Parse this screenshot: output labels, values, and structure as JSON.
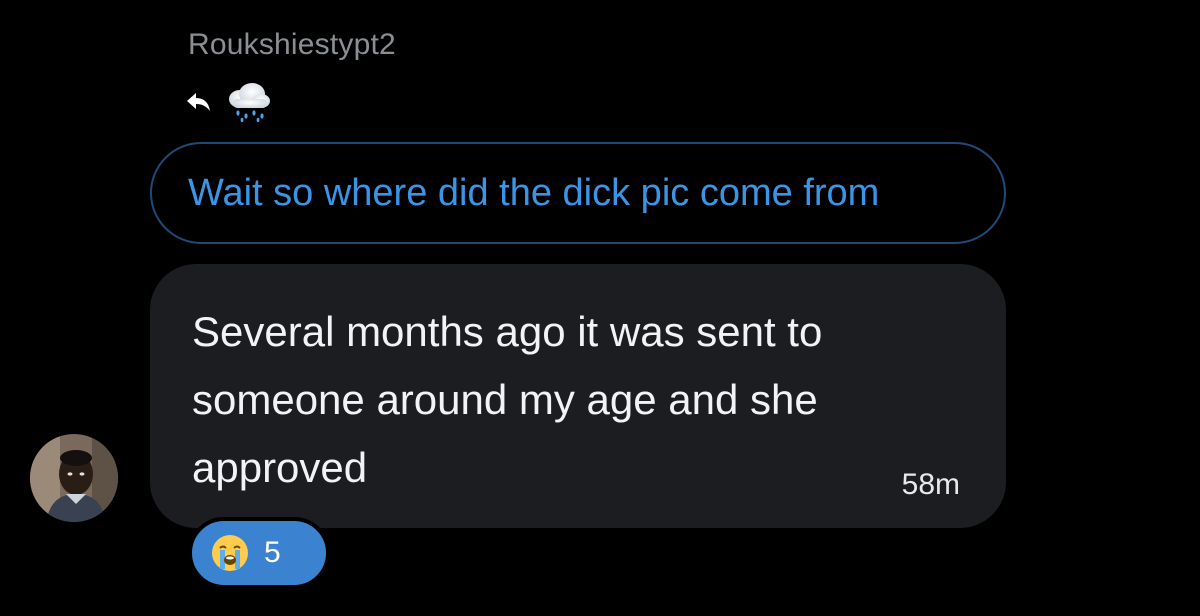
{
  "conversation": {
    "sender_name": "Roukshiestypt2",
    "reply_icon": "reply-arrow-icon",
    "reply_emoji": "cloud-with-rain-icon"
  },
  "quoted_message": {
    "text": "Wait so where did the dick pic come from",
    "color": "#3b95e6",
    "border_color": "#1f4a78"
  },
  "message": {
    "text": "Several months ago it was sent to someone around my age and she approved",
    "timestamp": "58m",
    "bubble_color": "#1b1d20"
  },
  "avatar": {
    "icon": "user-avatar"
  },
  "reaction": {
    "emoji": "loudly-crying-face-icon",
    "count": "5",
    "color": "#3b82d0"
  }
}
